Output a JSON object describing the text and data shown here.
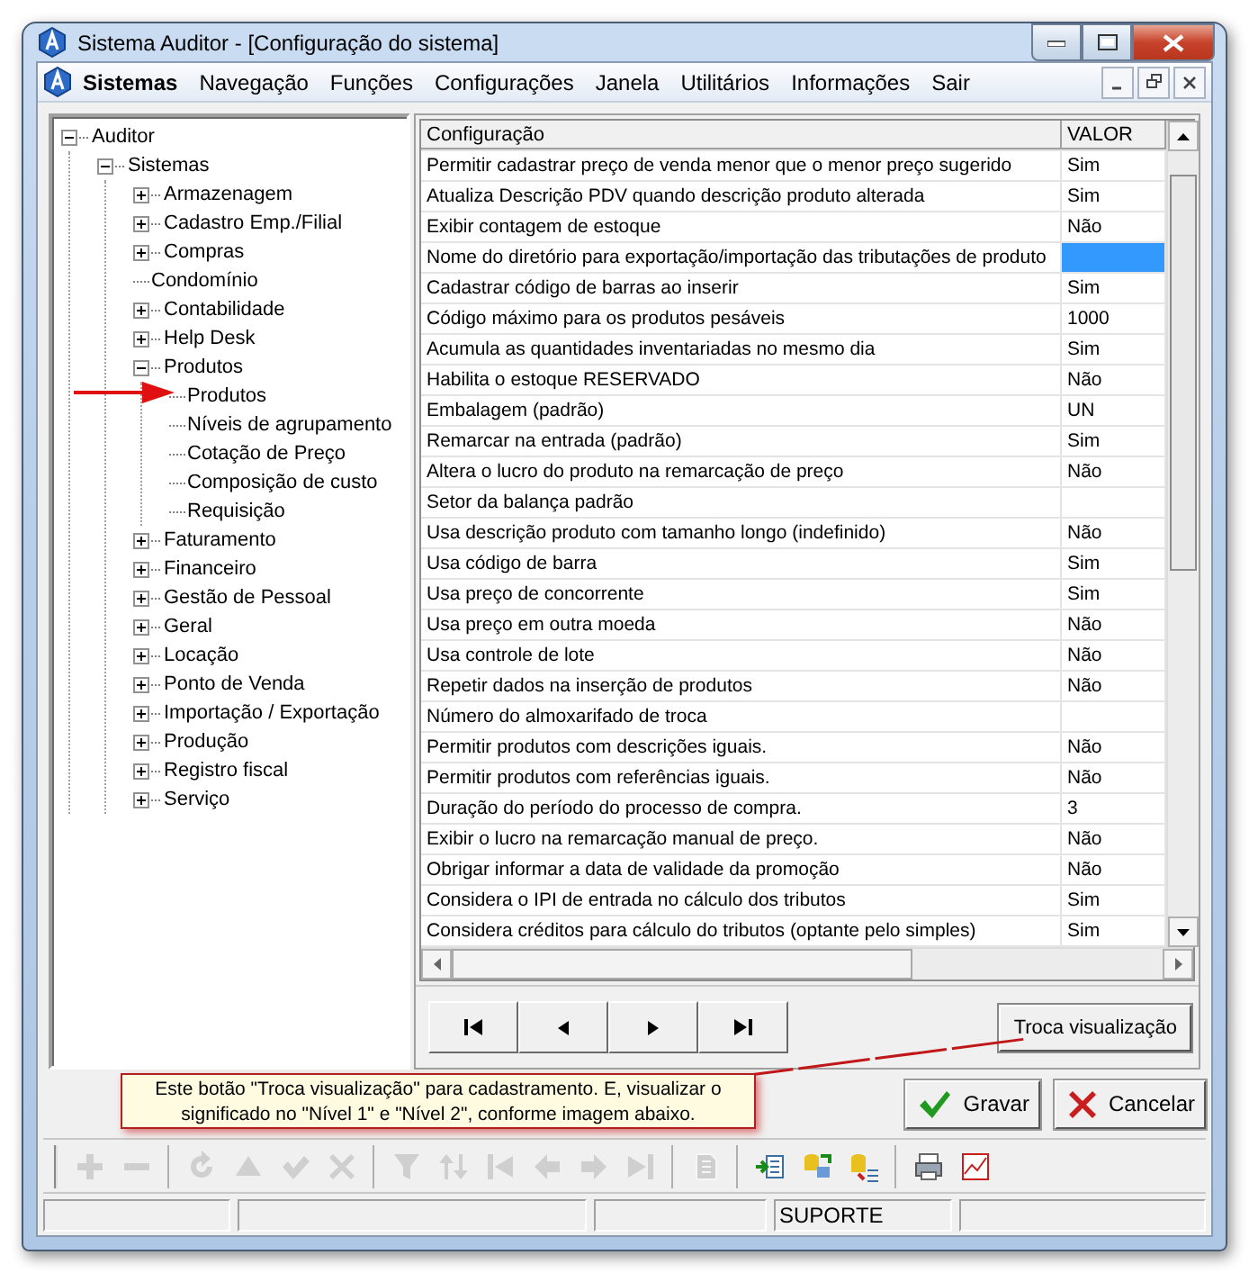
{
  "window": {
    "title": "Sistema Auditor - [Configuração do sistema]"
  },
  "menu": [
    {
      "label": "Sistemas",
      "emphasized": true
    },
    {
      "label": "Navegação",
      "emphasized": false
    },
    {
      "label": "Funções",
      "emphasized": false
    },
    {
      "label": "Configurações",
      "emphasized": false
    },
    {
      "label": "Janela",
      "emphasized": false
    },
    {
      "label": "Utilitários",
      "emphasized": false
    },
    {
      "label": "Informações",
      "emphasized": false
    },
    {
      "label": "Sair",
      "emphasized": false
    }
  ],
  "tree": [
    {
      "label": "Auditor",
      "expanded": true,
      "children": [
        {
          "label": "Sistemas",
          "expanded": true,
          "children": [
            {
              "label": "Armazenagem",
              "expanded": false
            },
            {
              "label": "Cadastro Emp./Filial",
              "expanded": false
            },
            {
              "label": "Compras",
              "expanded": false
            },
            {
              "label": "Condomínio"
            },
            {
              "label": "Contabilidade",
              "expanded": false
            },
            {
              "label": "Help Desk",
              "expanded": false
            },
            {
              "label": "Produtos",
              "expanded": true,
              "children": [
                {
                  "label": "Produtos",
                  "pointed": true
                },
                {
                  "label": "Níveis de agrupamento"
                },
                {
                  "label": "Cotação de Preço"
                },
                {
                  "label": "Composição de custo"
                },
                {
                  "label": "Requisição"
                }
              ]
            },
            {
              "label": "Faturamento",
              "expanded": false
            },
            {
              "label": "Financeiro",
              "expanded": false
            },
            {
              "label": "Gestão de Pessoal",
              "expanded": false
            },
            {
              "label": "Geral",
              "expanded": false
            },
            {
              "label": "Locação",
              "expanded": false
            },
            {
              "label": "Ponto de Venda",
              "expanded": false
            },
            {
              "label": "Importação / Exportação",
              "expanded": false
            },
            {
              "label": "Produção",
              "expanded": false
            },
            {
              "label": "Registro fiscal",
              "expanded": false
            },
            {
              "label": "Serviço",
              "expanded": false
            }
          ]
        }
      ]
    }
  ],
  "table": {
    "columns": [
      "Configuração",
      "VALOR"
    ],
    "rows": [
      {
        "setting": "Permitir cadastrar preço de venda menor que o menor preço sugerido",
        "value": "Sim",
        "selected": false
      },
      {
        "setting": "Atualiza Descrição PDV quando descrição produto alterada",
        "value": "Sim",
        "selected": false
      },
      {
        "setting": "Exibir contagem de estoque",
        "value": "Não",
        "selected": false
      },
      {
        "setting": "Nome do diretório para exportação/importação das tributações de produto",
        "selected": true
      },
      {
        "setting": "Cadastrar código de barras ao inserir",
        "value": "Sim",
        "selected": false
      },
      {
        "setting": "Código máximo para os produtos pesáveis",
        "value": "1000",
        "selected": false
      },
      {
        "setting": "Acumula as quantidades inventariadas no mesmo dia",
        "value": "Sim",
        "selected": false
      },
      {
        "setting": "Habilita o estoque RESERVADO",
        "value": "Não",
        "selected": false
      },
      {
        "setting": "Embalagem (padrão)",
        "value": "UN",
        "selected": false
      },
      {
        "setting": "Remarcar na entrada (padrão)",
        "value": "Sim",
        "selected": false
      },
      {
        "setting": "Altera o lucro do produto na remarcação de preço",
        "value": "Não",
        "selected": false
      },
      {
        "setting": "Setor da balança padrão",
        "selected": false
      },
      {
        "setting": "Usa descrição produto com tamanho longo (indefinido)",
        "value": "Não",
        "selected": false
      },
      {
        "setting": "Usa código de barra",
        "value": "Sim",
        "selected": false
      },
      {
        "setting": "Usa preço de concorrente",
        "value": "Sim",
        "selected": false
      },
      {
        "setting": "Usa preço em outra moeda",
        "value": "Não",
        "selected": false
      },
      {
        "setting": "Usa controle de lote",
        "value": "Não",
        "selected": false
      },
      {
        "setting": "Repetir dados na inserção de produtos",
        "value": "Não",
        "selected": false
      },
      {
        "setting": "Número do almoxarifado de troca",
        "selected": false
      },
      {
        "setting": "Permitir produtos com descrições iguais.",
        "value": "Não",
        "selected": false
      },
      {
        "setting": "Permitir produtos com referências iguais.",
        "value": "Não",
        "selected": false
      },
      {
        "setting": "Duração do período do processo de compra.",
        "value": "3",
        "selected": false
      },
      {
        "setting": "Exibir o lucro na remarcação manual de preço.",
        "value": "Não",
        "selected": false
      },
      {
        "setting": "Obrigar informar a data de validade da promoção",
        "value": "Não",
        "selected": false
      },
      {
        "setting": "Considera o IPI de entrada no cálculo dos tributos",
        "value": "Sim",
        "selected": false
      },
      {
        "setting": "Considera créditos para cálculo do tributos (optante pelo simples)",
        "value": "Sim",
        "selected": false
      }
    ]
  },
  "view_button": "Troca visualização",
  "callout": "Este botão \"Troca visualização\" para cadastramento. E, visualizar o significado no \"Nível 1\" e \"Nível 2\", conforme imagem abaixo.",
  "actions": [
    "Gravar",
    "Cancelar"
  ],
  "toolbar": [
    [
      {
        "disabled": true
      },
      {
        "disabled": true
      }
    ],
    [
      {
        "disabled": true
      },
      {
        "disabled": true
      },
      {
        "disabled": true
      },
      {
        "disabled": true
      }
    ],
    [
      {
        "disabled": true
      },
      {
        "disabled": true
      },
      {
        "disabled": true
      },
      {
        "disabled": true
      },
      {
        "disabled": true
      },
      {
        "disabled": true
      }
    ],
    [
      {
        "disabled": true
      }
    ],
    [
      {
        "disabled": false
      },
      {
        "disabled": false
      },
      {
        "disabled": false
      }
    ],
    [
      {
        "disabled": false
      },
      {
        "disabled": false
      }
    ]
  ],
  "status_bar": {
    "panel_4": "SUPORTE"
  }
}
